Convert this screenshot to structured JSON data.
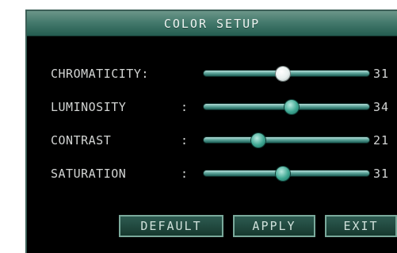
{
  "title": "COLOR SETUP",
  "settings": [
    {
      "label": "CHROMATICITY:",
      "colon": "",
      "value": "31",
      "level": 0.48,
      "selected": true
    },
    {
      "label": "LUMINOSITY",
      "colon": ":",
      "value": "34",
      "level": 0.53,
      "selected": false
    },
    {
      "label": "CONTRAST",
      "colon": ":",
      "value": "21",
      "level": 0.33,
      "selected": false
    },
    {
      "label": "SATURATION",
      "colon": ":",
      "value": "31",
      "level": 0.48,
      "selected": false
    }
  ],
  "buttons": {
    "default_label": "DEFAULT",
    "apply_label": "APPLY",
    "exit_label": "EXIT"
  },
  "colors": {
    "title_bar": "#457a6d",
    "background": "#000000",
    "track": "#5fa79c",
    "thumb": "#3ea792",
    "thumb_selected": "#ffffff",
    "text": "#d2d4d3"
  }
}
